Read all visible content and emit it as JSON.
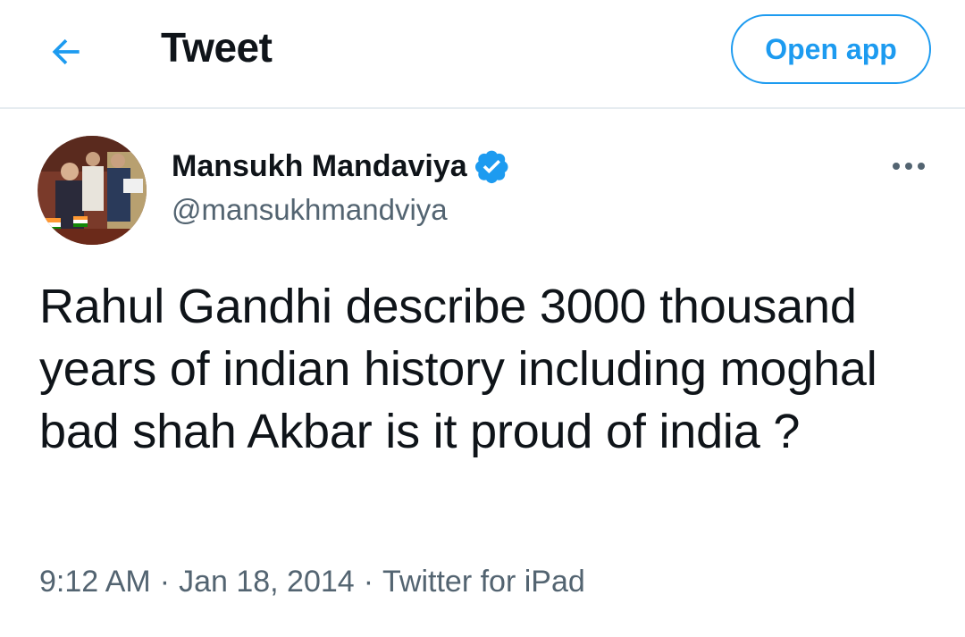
{
  "header": {
    "title": "Tweet",
    "back_icon": "arrow-left-icon",
    "open_app_label": "Open app"
  },
  "colors": {
    "accent": "#1d9bf0",
    "text": "#0f1419",
    "secondary": "#536471",
    "divider": "#e6ecf0"
  },
  "tweet": {
    "author_name": "Mansukh Mandaviya",
    "verified_icon": "verified-badge-icon",
    "handle": "@mansukhmandviya",
    "more_icon": "more-horizontal-icon",
    "text": "Rahul Gandhi describe 3000 thousand years of indian history including moghal bad shah Akbar is it proud of india ?",
    "time": "9:12 AM",
    "date": "Jan 18, 2014",
    "source": "Twitter for iPad",
    "separator": "·"
  }
}
